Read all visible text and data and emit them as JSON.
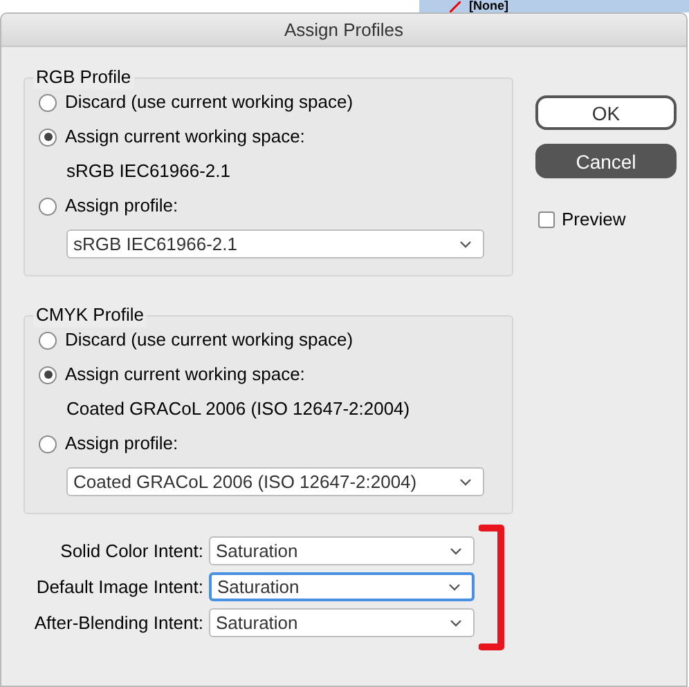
{
  "background_panel": {
    "text": "[None]"
  },
  "window": {
    "title": "Assign Profiles"
  },
  "groups": [
    {
      "title": "RGB Profile",
      "options": [
        {
          "label": "Discard (use current working space)",
          "selected": false
        },
        {
          "label": "Assign current working space:",
          "selected": true,
          "detail": "sRGB IEC61966-2.1"
        },
        {
          "label": "Assign profile:",
          "selected": false
        }
      ],
      "profile_select": {
        "value": "sRGB IEC61966-2.1"
      }
    },
    {
      "title": "CMYK Profile",
      "options": [
        {
          "label": "Discard (use current working space)",
          "selected": false
        },
        {
          "label": "Assign current working space:",
          "selected": true,
          "detail": "Coated GRACoL 2006 (ISO 12647-2:2004)"
        },
        {
          "label": "Assign profile:",
          "selected": false
        }
      ],
      "profile_select": {
        "value": "Coated GRACoL 2006 (ISO 12647-2:2004)"
      }
    }
  ],
  "intents": [
    {
      "label": "Solid Color Intent:",
      "value": "Saturation",
      "focused": false
    },
    {
      "label": "Default Image Intent:",
      "value": "Saturation",
      "focused": true
    },
    {
      "label": "After-Blending Intent:",
      "value": "Saturation",
      "focused": false
    }
  ],
  "buttons": [
    {
      "label": "OK",
      "kind": "default"
    },
    {
      "label": "Cancel",
      "kind": "dark"
    }
  ],
  "preview": {
    "label": "Preview",
    "checked": false
  }
}
